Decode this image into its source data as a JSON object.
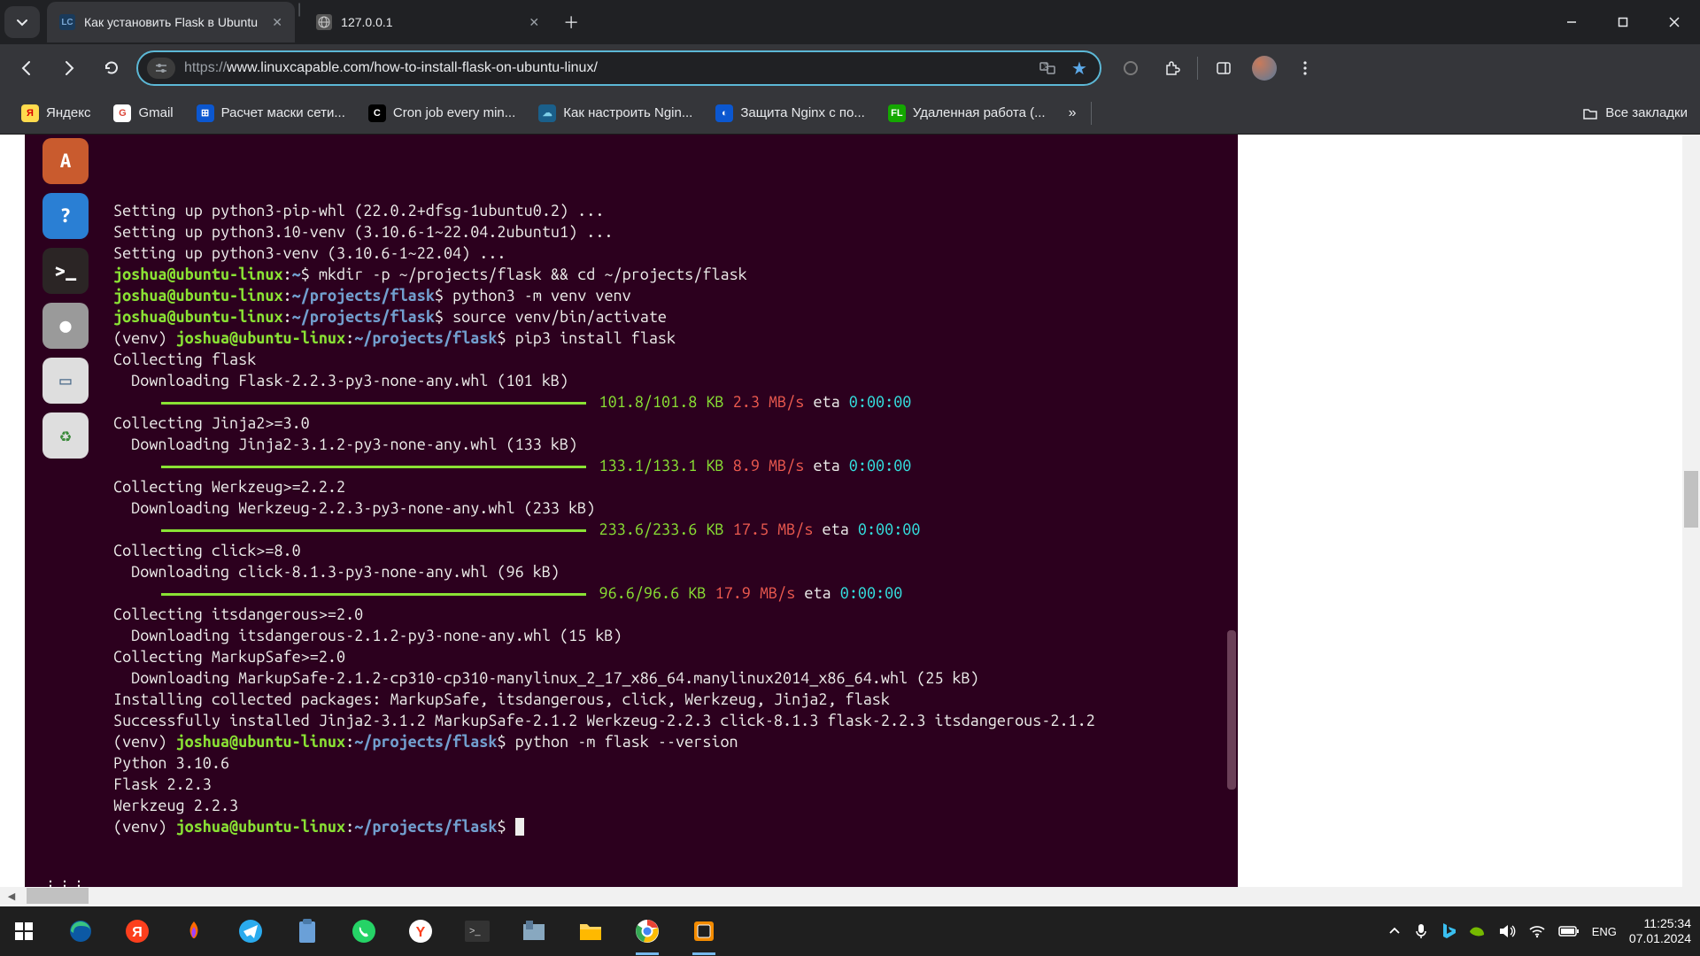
{
  "tabs": [
    {
      "title": "Как установить Flask в Ubuntu",
      "favicon_bg": "#1a3a5a",
      "favicon_text": "LC",
      "favicon_color": "#7aa7d4",
      "active": true
    },
    {
      "title": "127.0.0.1",
      "favicon_bg": "#555",
      "favicon_text": "",
      "active": false
    }
  ],
  "url": {
    "proto": "https://",
    "rest": "www.linuxcapable.com/how-to-install-flask-on-ubuntu-linux/"
  },
  "bookmarks": [
    {
      "label": "Яндекс",
      "ico_bg": "#ffdb4d",
      "ico_text": "Я",
      "ico_color": "#d80000"
    },
    {
      "label": "Gmail",
      "ico_bg": "#fff",
      "ico_text": "G",
      "ico_color": "#db4437"
    },
    {
      "label": "Расчет маски сети...",
      "ico_bg": "#0b57d0",
      "ico_text": "⊞",
      "ico_color": "#fff"
    },
    {
      "label": "Cron job every min...",
      "ico_bg": "#000",
      "ico_text": "C",
      "ico_color": "#fff"
    },
    {
      "label": "Как настроить Ngin...",
      "ico_bg": "#1a5f8a",
      "ico_text": "☁",
      "ico_color": "#7ecfe8"
    },
    {
      "label": "Защита Nginx с по...",
      "ico_bg": "#0b57d0",
      "ico_text": "◐",
      "ico_color": "#fff"
    },
    {
      "label": "Удаленная работа (...",
      "ico_bg": "#14a800",
      "ico_text": "FL",
      "ico_color": "#fff"
    }
  ],
  "all_bookmarks": "Все закладки",
  "dock": [
    {
      "bg": "#c95b2e",
      "label": "A"
    },
    {
      "bg": "#2a7fd4",
      "label": "?"
    },
    {
      "bg": "#2b2525",
      "label": ">_"
    },
    {
      "bg": "#9a9a9a",
      "label": "●"
    },
    {
      "bg": "#dedede",
      "label": "▭",
      "color": "#4a6a8a"
    },
    {
      "bg": "#dedede",
      "label": "♻",
      "color": "#3a8a3a"
    },
    {
      "bg": "transparent",
      "label": "⋮⋮⋮",
      "color": "#fff"
    }
  ],
  "terminal": {
    "lines": [
      {
        "t": "plain",
        "text": "Setting up python3-pip-whl (22.0.2+dfsg-1ubuntu0.2) ..."
      },
      {
        "t": "plain",
        "text": "Setting up python3.10-venv (3.10.6-1~22.04.2ubuntu1) ..."
      },
      {
        "t": "plain",
        "text": "Setting up python3-venv (3.10.6-1~22.04) ..."
      },
      {
        "t": "prompt",
        "user": "joshua@ubuntu-linux",
        "sep": ":",
        "path": "~",
        "dollar": "$",
        "cmd": " mkdir -p ~/projects/flask && cd ~/projects/flask"
      },
      {
        "t": "prompt",
        "user": "joshua@ubuntu-linux",
        "sep": ":",
        "path": "~/projects/flask",
        "dollar": "$",
        "cmd": " python3 -m venv venv"
      },
      {
        "t": "prompt",
        "user": "joshua@ubuntu-linux",
        "sep": ":",
        "path": "~/projects/flask",
        "dollar": "$",
        "cmd": " source venv/bin/activate"
      },
      {
        "t": "venvprompt",
        "venv": "(venv) ",
        "user": "joshua@ubuntu-linux",
        "sep": ":",
        "path": "~/projects/flask",
        "dollar": "$",
        "cmd": " pip3 install flask"
      },
      {
        "t": "plain",
        "text": "Collecting flask"
      },
      {
        "t": "plain",
        "text": "  Downloading Flask-2.2.3-py3-none-any.whl (101 kB)"
      },
      {
        "t": "progress",
        "size": "101.8/101.8 KB",
        "speed": "2.3 MB/s",
        "eta": "eta",
        "time": "0:00:00"
      },
      {
        "t": "plain",
        "text": "Collecting Jinja2>=3.0"
      },
      {
        "t": "plain",
        "text": "  Downloading Jinja2-3.1.2-py3-none-any.whl (133 kB)"
      },
      {
        "t": "progress",
        "size": "133.1/133.1 KB",
        "speed": "8.9 MB/s",
        "eta": "eta",
        "time": "0:00:00"
      },
      {
        "t": "plain",
        "text": "Collecting Werkzeug>=2.2.2"
      },
      {
        "t": "plain",
        "text": "  Downloading Werkzeug-2.2.3-py3-none-any.whl (233 kB)"
      },
      {
        "t": "progress",
        "size": "233.6/233.6 KB",
        "speed": "17.5 MB/s",
        "eta": "eta",
        "time": "0:00:00"
      },
      {
        "t": "plain",
        "text": "Collecting click>=8.0"
      },
      {
        "t": "plain",
        "text": "  Downloading click-8.1.3-py3-none-any.whl (96 kB)"
      },
      {
        "t": "progress",
        "size": "96.6/96.6 KB",
        "speed": "17.9 MB/s",
        "eta": "eta",
        "time": "0:00:00"
      },
      {
        "t": "plain",
        "text": "Collecting itsdangerous>=2.0"
      },
      {
        "t": "plain",
        "text": "  Downloading itsdangerous-2.1.2-py3-none-any.whl (15 kB)"
      },
      {
        "t": "plain",
        "text": "Collecting MarkupSafe>=2.0"
      },
      {
        "t": "plain",
        "text": "  Downloading MarkupSafe-2.1.2-cp310-cp310-manylinux_2_17_x86_64.manylinux2014_x86_64.whl (25 kB)"
      },
      {
        "t": "plain",
        "text": "Installing collected packages: MarkupSafe, itsdangerous, click, Werkzeug, Jinja2, flask"
      },
      {
        "t": "plain",
        "text": "Successfully installed Jinja2-3.1.2 MarkupSafe-2.1.2 Werkzeug-2.2.3 click-8.1.3 flask-2.2.3 itsdangerous-2.1.2"
      },
      {
        "t": "venvprompt",
        "venv": "(venv) ",
        "user": "joshua@ubuntu-linux",
        "sep": ":",
        "path": "~/projects/flask",
        "dollar": "$",
        "cmd": " python -m flask --version"
      },
      {
        "t": "plain",
        "text": "Python 3.10.6"
      },
      {
        "t": "plain",
        "text": "Flask 2.2.3"
      },
      {
        "t": "plain",
        "text": "Werkzeug 2.2.3"
      },
      {
        "t": "venvprompt",
        "venv": "(venv) ",
        "user": "joshua@ubuntu-linux",
        "sep": ":",
        "path": "~/projects/flask",
        "dollar": "$",
        "cmd": " ",
        "cursor": true
      }
    ]
  },
  "tray": {
    "lang": "ENG",
    "time": "11:25:34",
    "date": "07.01.2024"
  }
}
